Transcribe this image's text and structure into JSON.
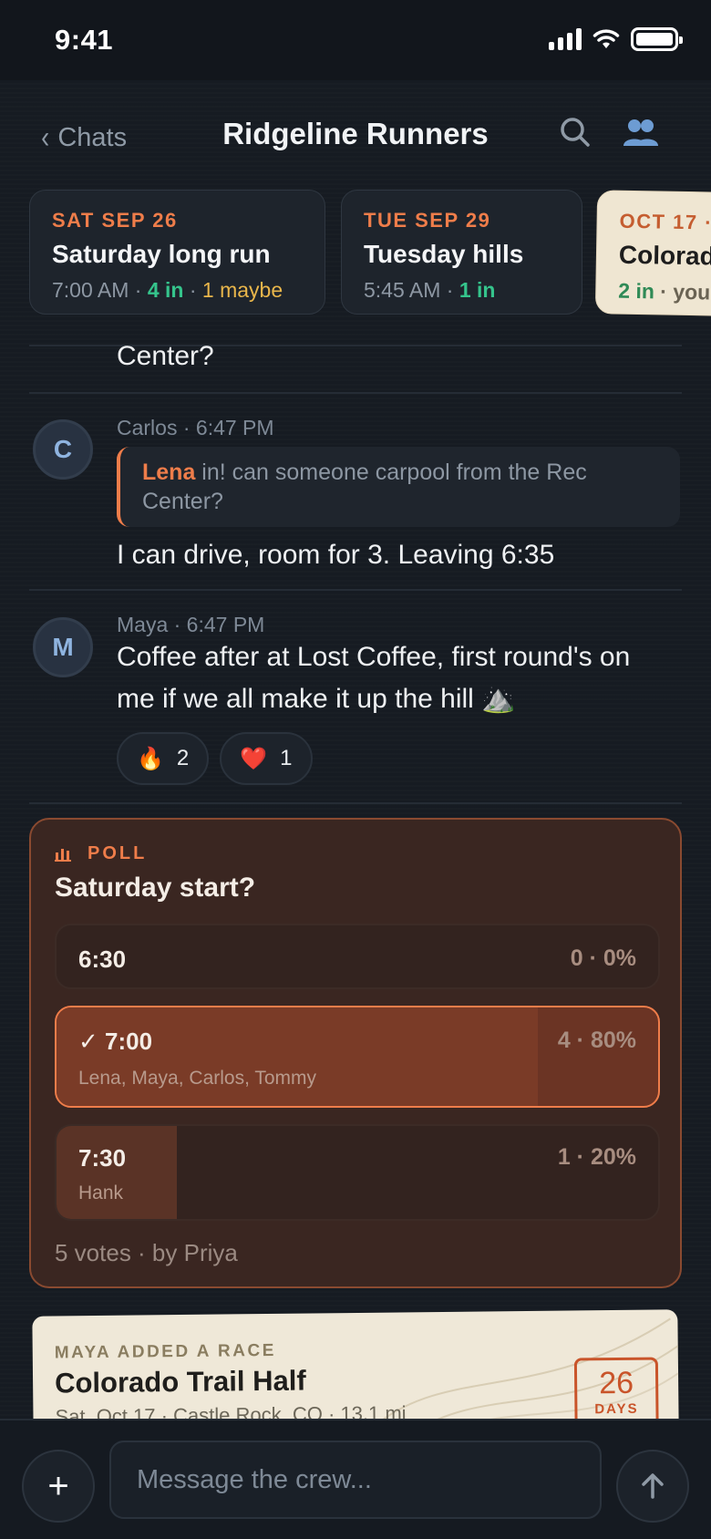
{
  "status": {
    "time": "9:41"
  },
  "header": {
    "back_label": "Chats",
    "title": "Ridgeline Runners"
  },
  "events": [
    {
      "date": "SAT SEP 26",
      "name": "Saturday long run",
      "time": "7:00 AM",
      "in": "4 in",
      "maybe": "1 maybe"
    },
    {
      "date": "TUE SEP 29",
      "name": "Tuesday hills",
      "time": "5:45 AM",
      "in": "1 in"
    },
    {
      "date": "OCT 17 ·",
      "name": "Colorad",
      "in": "2 in",
      "extra": "you"
    }
  ],
  "messages": {
    "fragment": "Center?",
    "carlos": {
      "initial": "C",
      "sender": "Carlos · 6:47 PM",
      "quote_name": "Lena",
      "quote_text": " in! can someone carpool from the Rec Center?",
      "text": "I can drive, room for 3. Leaving 6:35"
    },
    "maya": {
      "initial": "M",
      "sender": "Maya · 6:47 PM",
      "text": "Coffee after at Lost Coffee, first round's on me if we all make it up the hill ⛰️",
      "reactions": [
        {
          "emoji": "🔥",
          "count": "2"
        },
        {
          "emoji": "❤️",
          "count": "1"
        }
      ]
    }
  },
  "poll": {
    "label": "POLL",
    "question": "Saturday start?",
    "options": [
      {
        "label": "6:30",
        "count": "0 · 0%",
        "voters": "",
        "fraction": 0
      },
      {
        "label": "✓ 7:00",
        "count": "4 · 80%",
        "voters": "Lena, Maya, Carlos, Tommy",
        "fraction": 0.8
      },
      {
        "label": "7:30",
        "count": "1 · 20%",
        "voters": "Hank",
        "fraction": 0.2
      }
    ],
    "footer": "5 votes · by Priya"
  },
  "race": {
    "tag": "MAYA ADDED A RACE",
    "name": "Colorado Trail Half",
    "meta": "Sat, Oct 17 · Castle Rock, CO · 13.1 mi",
    "days_number": "26",
    "days_label": "DAYS"
  },
  "composer": {
    "placeholder": "Message the crew..."
  },
  "colors": {
    "accent": "#ef7d4a",
    "in_green": "#35c48c",
    "maybe_yellow": "#e9b64b",
    "background": "#161b22"
  }
}
